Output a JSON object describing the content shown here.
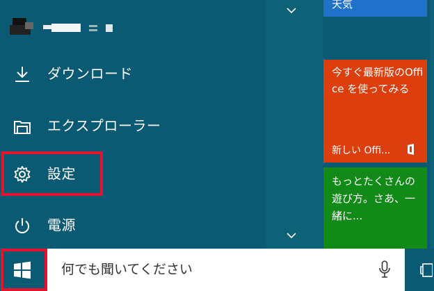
{
  "start_menu": {
    "user": {
      "name": ""
    },
    "items": [
      {
        "label": "ダウンロード",
        "icon": "download-icon"
      },
      {
        "label": "エクスプローラー",
        "icon": "folder-explorer-icon"
      },
      {
        "label": "設定",
        "icon": "gear-icon"
      },
      {
        "label": "電源",
        "icon": "power-icon"
      }
    ],
    "tiles": {
      "weather": {
        "label": "天気",
        "color": "#1f71c9"
      },
      "office": {
        "text": "今すぐ最新版のOffice を使ってみる",
        "footer": "新しい Offi...",
        "color": "#dc3e0d"
      },
      "xbox": {
        "text": "もっとたくさんの遊び方。さあ、一緒に...",
        "color": "#118a18"
      }
    },
    "background": "#0b5a73",
    "highlight_color": "#e3152e"
  },
  "taskbar": {
    "search": {
      "placeholder": "何でも聞いてください"
    },
    "icons": [
      "windows-logo-icon",
      "microphone-icon",
      "task-view-icon"
    ]
  }
}
